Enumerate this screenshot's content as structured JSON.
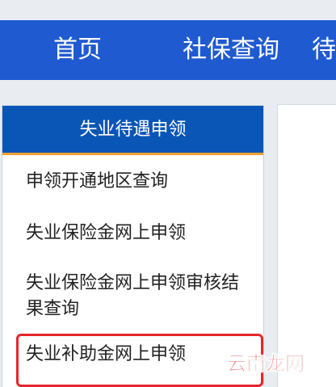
{
  "nav": {
    "items": [
      "首页",
      "社保查询",
      "待"
    ]
  },
  "sidebar": {
    "title": "失业待遇申领",
    "items": [
      "申领开通地区查询",
      "失业保险金网上申领",
      "失业保险金网上申领审核结果查询",
      "失业补助金网上申领"
    ]
  },
  "watermark": "云南龙网",
  "colors": {
    "nav_bg": "#1f5ad0",
    "sidebar_header_bg": "#0a56b6",
    "accent_orange": "#f2a12c",
    "highlight_red": "#e5262b"
  }
}
